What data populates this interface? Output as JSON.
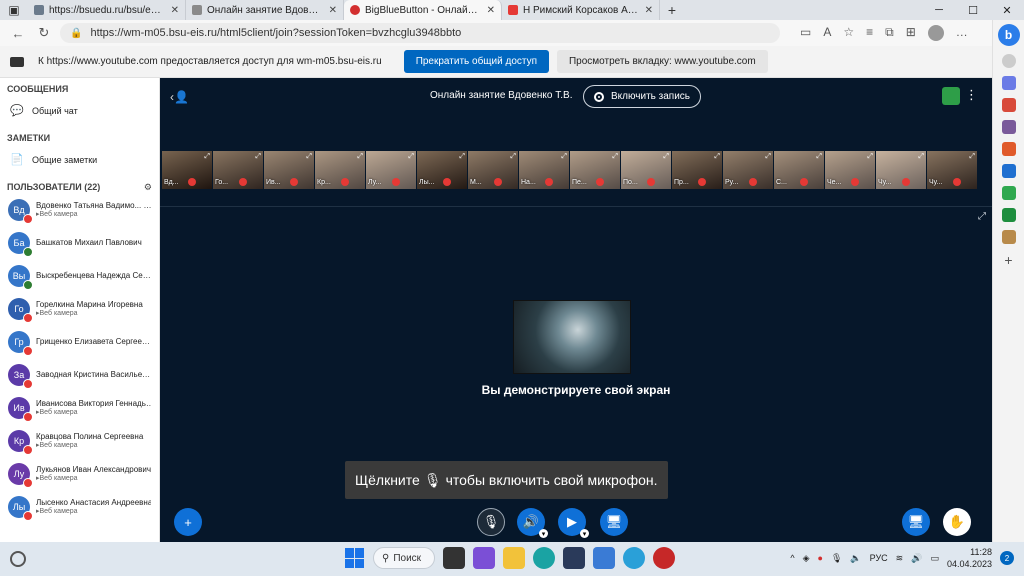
{
  "browser": {
    "tabs": [
      {
        "title": "https://bsuedu.ru/bsu/education",
        "color": "#6b7b8c"
      },
      {
        "title": "Онлайн занятие Вдовенко Т.В.",
        "color": "#8a8a8a"
      },
      {
        "title": "BigBlueButton - Онлайн за...",
        "color": "#d32f2f"
      },
      {
        "title": "Н Римский Корсаков Ария",
        "color": "#e53935"
      }
    ],
    "url": "https://wm-m05.bsu-eis.ru/html5client/join?sessionToken=bvzhcglu3948bbto"
  },
  "sharebar": {
    "message": "К https://www.youtube.com предоставляется доступ для wm-m05.bsu-eis.ru",
    "stop_button": "Прекратить общий доступ",
    "view_button": "Просмотреть вкладку: www.youtube.com"
  },
  "sidebar": {
    "messages_header": "СООБЩЕНИЯ",
    "public_chat": "Общий чат",
    "notes_header": "ЗАМЕТКИ",
    "shared_notes": "Общие заметки",
    "users_header": "ПОЛЬЗОВАТЕЛИ (22)",
    "users": [
      {
        "initials": "Вд",
        "name": "Вдовенко Татьяна Вадимо...",
        "you": "(Вы)",
        "sub": "Веб камера",
        "color": "#3b6fb6",
        "mic": "red"
      },
      {
        "initials": "Ба",
        "name": "Башкатов Михаил Павлович",
        "you": "",
        "sub": "",
        "color": "#3576c9",
        "mic": "green"
      },
      {
        "initials": "Вы",
        "name": "Выскребенцева Надежда Серг...",
        "you": "",
        "sub": "",
        "color": "#3576c9",
        "mic": "green"
      },
      {
        "initials": "Го",
        "name": "Горелкина Марина Игоревна",
        "you": "",
        "sub": "Веб камера",
        "color": "#2f5fae",
        "mic": "red"
      },
      {
        "initials": "Гр",
        "name": "Грищенко Елизавета Сергеевна",
        "you": "",
        "sub": "",
        "color": "#3576c9",
        "mic": "red"
      },
      {
        "initials": "За",
        "name": "Заводная Кристина Васильевна",
        "you": "",
        "sub": "",
        "color": "#5b3aa8",
        "mic": "red"
      },
      {
        "initials": "Ив",
        "name": "Иванисова Виктория Геннадье...",
        "you": "",
        "sub": "Веб камера",
        "color": "#5b3aa8",
        "mic": "red"
      },
      {
        "initials": "Кр",
        "name": "Кравцова Полина Сергеевна",
        "you": "",
        "sub": "Веб камера",
        "color": "#5b3aa8",
        "mic": "red"
      },
      {
        "initials": "Лу",
        "name": "Лукьянов Иван Александрович",
        "you": "",
        "sub": "Веб камера",
        "color": "#6a3aa8",
        "mic": "red"
      },
      {
        "initials": "Лы",
        "name": "Лысенко Анастасия Андреевна",
        "you": "",
        "sub": "Веб камера",
        "color": "#3576c9",
        "mic": "red"
      }
    ]
  },
  "meeting": {
    "title": "Онлайн занятие Вдовенко Т.В.",
    "record_label": "Включить запись",
    "cams": [
      "Вд...",
      "Го...",
      "Ив...",
      "Кр...",
      "Лу...",
      "Лы...",
      "М...",
      "На...",
      "Пе...",
      "По...",
      "Пр...",
      "Ру...",
      "С...",
      "Че...",
      "Чу...",
      "Чу..."
    ],
    "sharing_text": "Вы демонстрируете свой экран",
    "mic_hint_left": "Щёлкните",
    "mic_hint_right": "чтобы включить свой микрофон."
  },
  "taskbar": {
    "search": "Поиск",
    "lang": "РУС",
    "time": "11:28",
    "date": "04.04.2023",
    "badge": "2"
  }
}
